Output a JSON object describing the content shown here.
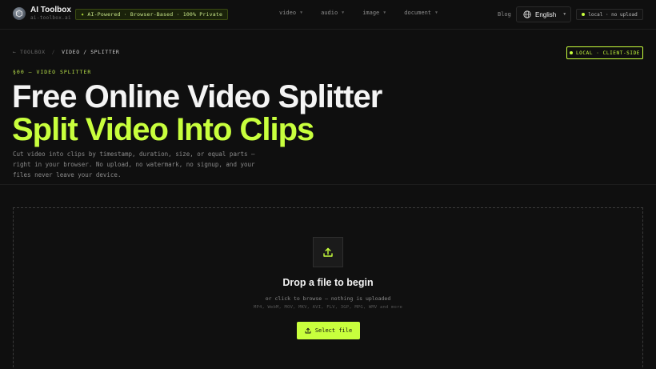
{
  "header": {
    "logo_title": "AI Toolbox",
    "logo_subtitle": "ai-toolbox.ai",
    "badge": "AI-Powered · Browser-Based · 100% Private",
    "nav": [
      {
        "label": "video"
      },
      {
        "label": "audio"
      },
      {
        "label": "image"
      },
      {
        "label": "document"
      }
    ],
    "blog": "Blog",
    "language": "English",
    "local_badge": "local · no upload"
  },
  "breadcrumb": {
    "back": "← TOOLBOX",
    "separator": "/",
    "current": "VIDEO / SPLITTER"
  },
  "client_badge": "LOCAL · CLIENT-SIDE",
  "hero": {
    "eyebrow": "§00 — VIDEO SPLITTER",
    "title_line1": "Free Online Video Splitter",
    "title_line2": "Split Video Into Clips",
    "description": "Cut video into clips by timestamp, duration, size, or equal parts — right in your browser. No upload, no watermark, no signup, and your files never leave your device."
  },
  "dropzone": {
    "title": "Drop a file to begin",
    "subtitle": "or click to browse — nothing is uploaded",
    "formats": "MP4, WebM, MOV, MKV, AVI, FLV, 3GP, MPG, WMV and more",
    "button": "Select file"
  },
  "colors": {
    "accent": "#c8ff3d",
    "background": "#0f0f0f"
  }
}
